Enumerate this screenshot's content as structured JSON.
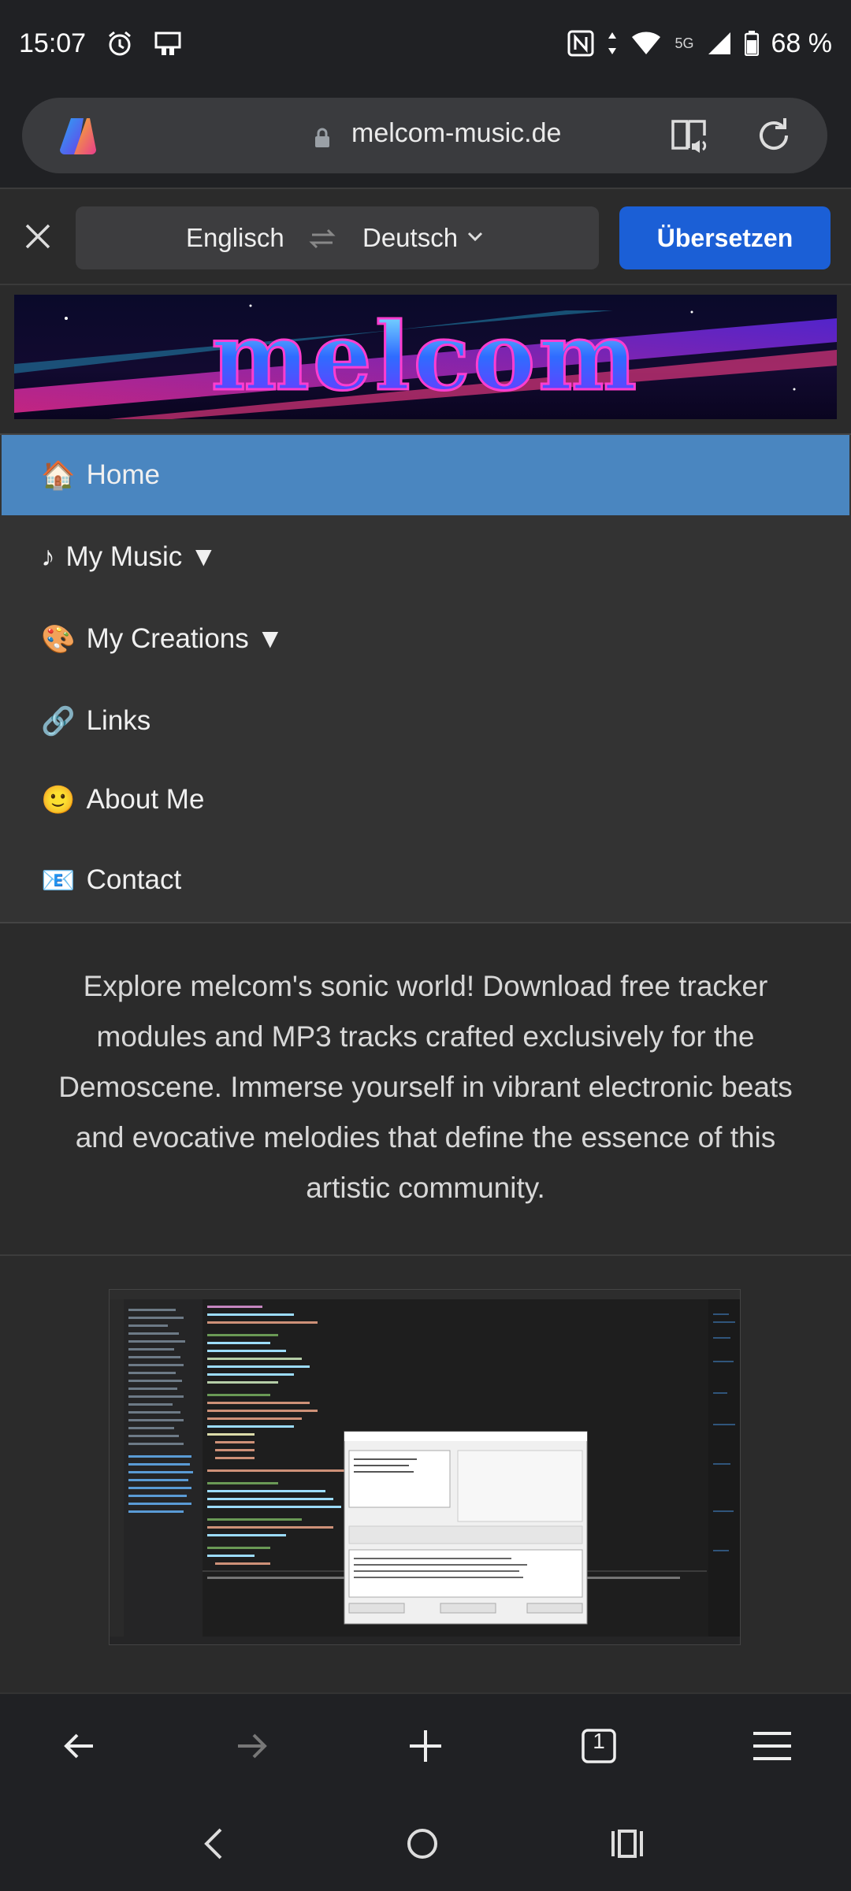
{
  "status": {
    "time": "15:07",
    "network": "5G",
    "battery": "68 %"
  },
  "url_bar": {
    "domain": "melcom-music.de"
  },
  "translate": {
    "from_lang": "Englisch",
    "to_lang": "Deutsch",
    "button": "Übersetzen"
  },
  "banner": {
    "logo_text": "melcom"
  },
  "nav": {
    "items": [
      {
        "emoji": "🏠",
        "label": "Home",
        "active": true
      },
      {
        "emoji": "♪",
        "label": "My Music ▼",
        "active": false
      },
      {
        "emoji": "🎨",
        "label": "My Creations ▼",
        "active": false
      },
      {
        "emoji": "🔗",
        "label": "Links",
        "active": false
      },
      {
        "emoji": "🙂",
        "label": "About Me",
        "active": false
      },
      {
        "emoji": "📧",
        "label": "Contact",
        "active": false
      }
    ]
  },
  "intro": "Explore melcom's sonic world! Download free tracker modules and MP3 tracks crafted exclusively for the Demoscene. Immerse yourself in vibrant electronic beats and evocative melodies that define the essence of this artistic community.",
  "browser_toolbar": {
    "tab_count": "1"
  },
  "colors": {
    "active_nav": "#4a86c0",
    "translate_button": "#1b5fd6",
    "background": "#2b2b2b"
  }
}
